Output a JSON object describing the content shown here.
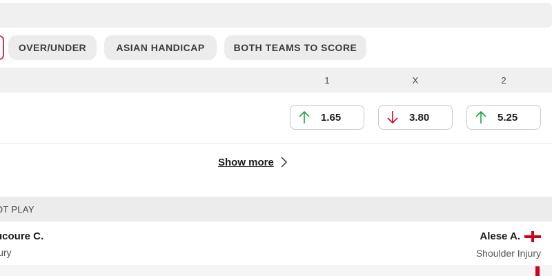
{
  "tabs": [
    {
      "label": "OVER/UNDER"
    },
    {
      "label": "ASIAN HANDICAP"
    },
    {
      "label": "BOTH TEAMS TO SCORE"
    }
  ],
  "odds_header": {
    "col1": "1",
    "colx": "X",
    "col2": "2"
  },
  "odds": [
    {
      "value": "1.65",
      "trend": "up"
    },
    {
      "value": "3.80",
      "trend": "down"
    },
    {
      "value": "5.25",
      "trend": "up"
    }
  ],
  "colors": {
    "up": "#1aa34a",
    "down": "#d0021b",
    "accent": "#d9345a"
  },
  "show_more": {
    "label": "Show more"
  },
  "missing_section": {
    "title": "OT PLAY"
  },
  "players": {
    "left": {
      "name": "ucoure C.",
      "reason": "jury"
    },
    "right": {
      "name": "Alese A.",
      "reason": "Shoulder Injury",
      "flag": "england-flag-icon"
    }
  }
}
